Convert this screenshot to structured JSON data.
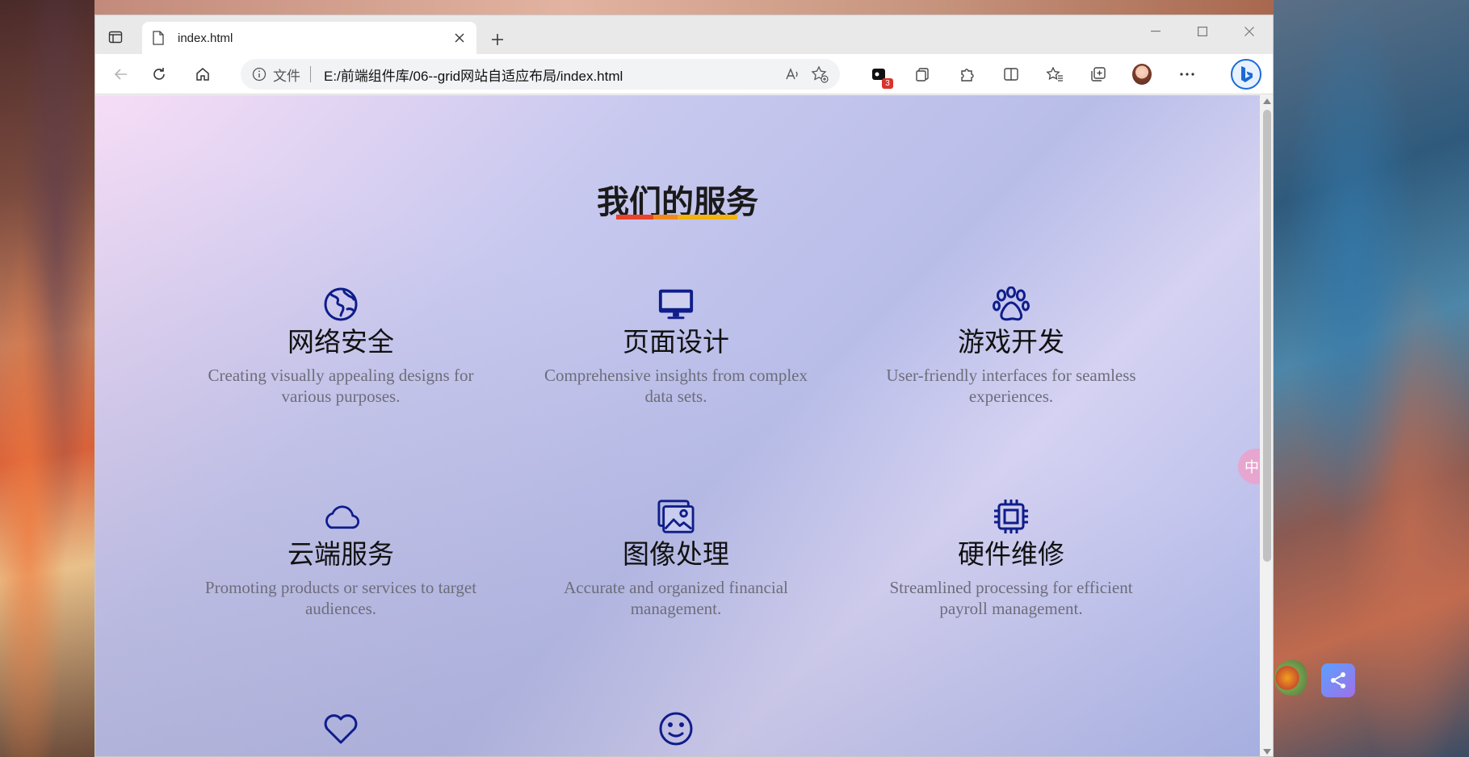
{
  "browser": {
    "tab": {
      "title": "index.html"
    },
    "address_bar": {
      "scheme_label": "文件",
      "url": "E:/前端组件库/06--grid网站自适应布局/index.html"
    },
    "extensions": {
      "badge_count": "3"
    }
  },
  "page": {
    "section_title": "我们的服务",
    "underline_colors": [
      "#e8442a",
      "#f08a1e",
      "#f2b20f"
    ],
    "services": [
      {
        "icon": "globe-icon",
        "title": "网络安全",
        "description": "Creating visually appealing designs for various purposes."
      },
      {
        "icon": "monitor-icon",
        "title": "页面设计",
        "description": "Comprehensive insights from complex data sets."
      },
      {
        "icon": "paw-icon",
        "title": "游戏开发",
        "description": "User-friendly interfaces for seamless experiences."
      },
      {
        "icon": "cloud-icon",
        "title": "云端服务",
        "description": "Promoting products or services to target audiences."
      },
      {
        "icon": "images-icon",
        "title": "图像处理",
        "description": "Accurate and organized financial management."
      },
      {
        "icon": "cpu-icon",
        "title": "硬件维修",
        "description": "Streamlined processing for efficient payroll management."
      },
      {
        "icon": "heart-icon"
      },
      {
        "icon": "smile-icon"
      }
    ],
    "icon_color": "#0f1d8a"
  },
  "overlay": {
    "translate_label": "中"
  }
}
